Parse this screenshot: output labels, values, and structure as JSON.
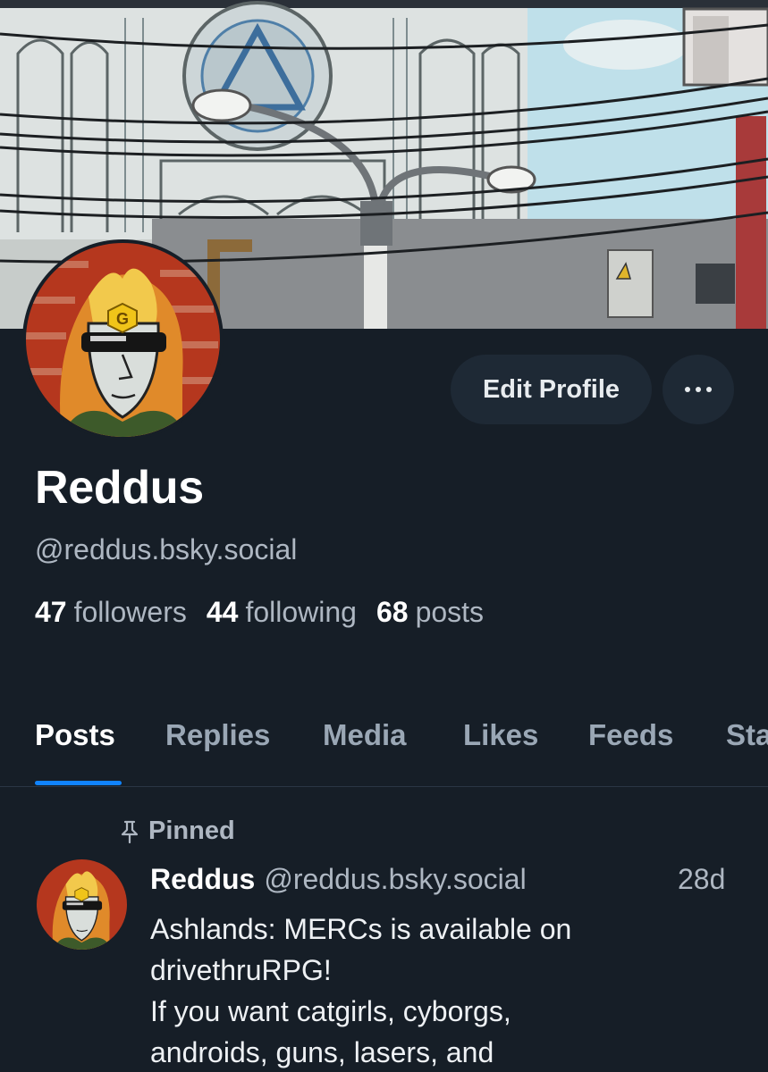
{
  "profile": {
    "display_name": "Reddus",
    "handle": "@reddus.bsky.social",
    "followers_count": "47",
    "followers_label": "followers",
    "following_count": "44",
    "following_label": "following",
    "posts_count": "68",
    "posts_label": "posts"
  },
  "actions": {
    "edit_label": "Edit Profile",
    "more_icon": "more-horizontal-icon"
  },
  "tabs": [
    {
      "label": "Posts",
      "active": true
    },
    {
      "label": "Replies",
      "active": false
    },
    {
      "label": "Media",
      "active": false
    },
    {
      "label": "Likes",
      "active": false
    },
    {
      "label": "Feeds",
      "active": false
    },
    {
      "label": "Sta",
      "active": false
    }
  ],
  "pinned_post": {
    "pinned_label": "Pinned",
    "pin_icon": "pin-icon",
    "author": "Reddus",
    "handle": "@reddus.bsky.social",
    "time": "28d",
    "lines": [
      "Ashlands: MERCs is available on",
      "drivethruRPG!",
      "If you want catgirls, cyborgs,",
      "androids, guns, lasers, and"
    ]
  },
  "colors": {
    "background": "#161e27",
    "accent": "#1083fe",
    "muted_text": "#aeb7c2",
    "button_bg": "#1e2935"
  }
}
